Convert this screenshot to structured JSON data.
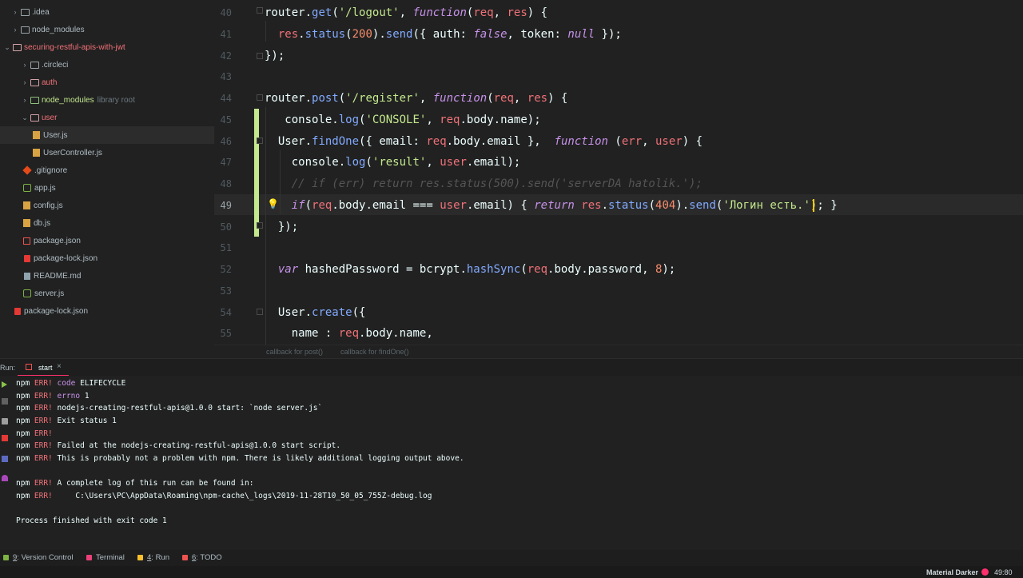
{
  "project_tree": {
    "items": [
      {
        "label": ".idea",
        "kind": "folder",
        "color": "#b0bec5",
        "chev": "›"
      },
      {
        "label": "node_modules",
        "kind": "folder",
        "color": "#b0bec5",
        "chev": "›"
      },
      {
        "label": "securing-restful-apis-with-jwt",
        "kind": "folder",
        "color": "#f07178",
        "chev": "⌄"
      },
      {
        "label": ".circleci",
        "kind": "folder",
        "color": "#b0bec5",
        "chev": "›"
      },
      {
        "label": "auth",
        "kind": "folder",
        "color": "#f07178",
        "chev": "›"
      },
      {
        "label": "node_modules",
        "suffix": "library root",
        "kind": "folder",
        "color": "#c3e88d",
        "chev": "›"
      },
      {
        "label": "user",
        "kind": "folder",
        "color": "#f07178",
        "chev": "⌄"
      },
      {
        "label": "User.js",
        "kind": "js",
        "color": "#b0bec5"
      },
      {
        "label": "UserController.js",
        "kind": "js",
        "color": "#b0bec5"
      },
      {
        "label": ".gitignore",
        "kind": "git",
        "color": "#b0bec5"
      },
      {
        "label": "app.js",
        "kind": "jsgreen",
        "color": "#b0bec5"
      },
      {
        "label": "config.js",
        "kind": "js",
        "color": "#b0bec5"
      },
      {
        "label": "db.js",
        "kind": "js",
        "color": "#b0bec5"
      },
      {
        "label": "package.json",
        "kind": "pkg",
        "color": "#b0bec5"
      },
      {
        "label": "package-lock.json",
        "kind": "lock",
        "color": "#b0bec5"
      },
      {
        "label": "README.md",
        "kind": "md",
        "color": "#b0bec5"
      },
      {
        "label": "server.js",
        "kind": "jsgreen",
        "color": "#b0bec5"
      },
      {
        "label": "package-lock.json",
        "kind": "lock",
        "color": "#b0bec5"
      }
    ]
  },
  "editor": {
    "line_numbers": [
      "40",
      "41",
      "42",
      "43",
      "44",
      "45",
      "46",
      "47",
      "48",
      "49",
      "50",
      "51",
      "52",
      "53",
      "54",
      "55"
    ],
    "current_line": "49",
    "lines": [
      [
        [
          "d",
          "router."
        ],
        [
          "f",
          "get"
        ],
        [
          "p",
          "("
        ],
        [
          "s",
          "'/logout'"
        ],
        [
          "p",
          ", "
        ],
        [
          "k",
          "function"
        ],
        [
          "p",
          "("
        ],
        [
          "v",
          "req"
        ],
        [
          "p",
          ", "
        ],
        [
          "v",
          "res"
        ],
        [
          "p",
          ") {"
        ]
      ],
      [
        [
          "d",
          "  "
        ],
        [
          "v",
          "res"
        ],
        [
          "p",
          "."
        ],
        [
          "f",
          "status"
        ],
        [
          "p",
          "("
        ],
        [
          "n",
          "200"
        ],
        [
          "p",
          ")."
        ],
        [
          "f",
          "send"
        ],
        [
          "p",
          "({ "
        ],
        [
          "d",
          "auth"
        ],
        [
          "p",
          ": "
        ],
        [
          "k",
          "false"
        ],
        [
          "p",
          ", "
        ],
        [
          "d",
          "token"
        ],
        [
          "p",
          ": "
        ],
        [
          "k",
          "null"
        ],
        [
          "p",
          " });"
        ]
      ],
      [
        [
          "p",
          "});"
        ]
      ],
      [],
      [
        [
          "d",
          "router."
        ],
        [
          "f",
          "post"
        ],
        [
          "p",
          "("
        ],
        [
          "s",
          "'/register'"
        ],
        [
          "p",
          ", "
        ],
        [
          "k",
          "function"
        ],
        [
          "p",
          "("
        ],
        [
          "v",
          "req"
        ],
        [
          "p",
          ", "
        ],
        [
          "v",
          "res"
        ],
        [
          "p",
          ") {"
        ]
      ],
      [
        [
          "d",
          "   console."
        ],
        [
          "f",
          "log"
        ],
        [
          "p",
          "("
        ],
        [
          "s",
          "'CONSOLE'"
        ],
        [
          "p",
          ", "
        ],
        [
          "v",
          "req"
        ],
        [
          "p",
          "."
        ],
        [
          "d",
          "body"
        ],
        [
          "p",
          "."
        ],
        [
          "d",
          "name"
        ],
        [
          "p",
          ");"
        ]
      ],
      [
        [
          "d",
          "  User."
        ],
        [
          "f",
          "findOne"
        ],
        [
          "p",
          "({ "
        ],
        [
          "d",
          "email"
        ],
        [
          "p",
          ": "
        ],
        [
          "v",
          "req"
        ],
        [
          "p",
          "."
        ],
        [
          "d",
          "body"
        ],
        [
          "p",
          "."
        ],
        [
          "d",
          "email"
        ],
        [
          "p",
          " },  "
        ],
        [
          "k",
          "function"
        ],
        [
          "p",
          " ("
        ],
        [
          "v",
          "err"
        ],
        [
          "p",
          ", "
        ],
        [
          "v",
          "user"
        ],
        [
          "p",
          ") {"
        ]
      ],
      [
        [
          "d",
          "    console."
        ],
        [
          "f",
          "log"
        ],
        [
          "p",
          "("
        ],
        [
          "s",
          "'result'"
        ],
        [
          "p",
          ", "
        ],
        [
          "v",
          "user"
        ],
        [
          "p",
          "."
        ],
        [
          "d",
          "email"
        ],
        [
          "p",
          ");"
        ]
      ],
      [
        [
          "c",
          "    // if (err) return res.status(500).send('serverDA hatolik.');"
        ]
      ],
      [
        [
          "d",
          "    "
        ],
        [
          "k",
          "if"
        ],
        [
          "p",
          "("
        ],
        [
          "v",
          "req"
        ],
        [
          "p",
          "."
        ],
        [
          "d",
          "body"
        ],
        [
          "p",
          "."
        ],
        [
          "d",
          "email"
        ],
        [
          "p",
          " === "
        ],
        [
          "v",
          "user"
        ],
        [
          "p",
          "."
        ],
        [
          "d",
          "email"
        ],
        [
          "p",
          ") { "
        ],
        [
          "k",
          "return"
        ],
        [
          "p",
          " "
        ],
        [
          "v",
          "res"
        ],
        [
          "p",
          "."
        ],
        [
          "f",
          "status"
        ],
        [
          "p",
          "("
        ],
        [
          "n",
          "404"
        ],
        [
          "p",
          ")."
        ],
        [
          "f",
          "send"
        ],
        [
          "p",
          "("
        ],
        [
          "s",
          "'Логин есть.'"
        ],
        [
          "p",
          "); }"
        ]
      ],
      [
        [
          "p",
          "  });"
        ]
      ],
      [],
      [
        [
          "d",
          "  "
        ],
        [
          "k",
          "var"
        ],
        [
          "d",
          " hashedPassword = bcrypt."
        ],
        [
          "f",
          "hashSync"
        ],
        [
          "p",
          "("
        ],
        [
          "v",
          "req"
        ],
        [
          "p",
          "."
        ],
        [
          "d",
          "body"
        ],
        [
          "p",
          "."
        ],
        [
          "d",
          "password"
        ],
        [
          "p",
          ", "
        ],
        [
          "n",
          "8"
        ],
        [
          "p",
          ");"
        ]
      ],
      [],
      [
        [
          "d",
          "  User."
        ],
        [
          "f",
          "create"
        ],
        [
          "p",
          "({"
        ]
      ],
      [
        [
          "d",
          "    name "
        ],
        [
          "p",
          ": "
        ],
        [
          "v",
          "req"
        ],
        [
          "p",
          "."
        ],
        [
          "d",
          "body"
        ],
        [
          "p",
          "."
        ],
        [
          "d",
          "name"
        ],
        [
          "p",
          ","
        ]
      ]
    ]
  },
  "breadcrumb": {
    "items": [
      "callback for post()",
      "callback for findOne()"
    ]
  },
  "run_panel": {
    "label": "Run:",
    "tab": "start",
    "close": "×"
  },
  "console": {
    "lines": [
      [
        [
          "w",
          "npm "
        ],
        [
          "r",
          "ERR! "
        ],
        [
          "m",
          "code"
        ],
        [
          "w",
          " ELIFECYCLE"
        ]
      ],
      [
        [
          "w",
          "npm "
        ],
        [
          "r",
          "ERR! "
        ],
        [
          "m",
          "errno"
        ],
        [
          "w",
          " 1"
        ]
      ],
      [
        [
          "w",
          "npm "
        ],
        [
          "r",
          "ERR! "
        ],
        [
          "w",
          "nodejs-creating-restful-apis@1.0.0 start: `node server.js`"
        ]
      ],
      [
        [
          "w",
          "npm "
        ],
        [
          "r",
          "ERR! "
        ],
        [
          "w",
          "Exit status 1"
        ]
      ],
      [
        [
          "w",
          "npm "
        ],
        [
          "r",
          "ERR!"
        ]
      ],
      [
        [
          "w",
          "npm "
        ],
        [
          "r",
          "ERR! "
        ],
        [
          "w",
          "Failed at the nodejs-creating-restful-apis@1.0.0 start script."
        ]
      ],
      [
        [
          "w",
          "npm "
        ],
        [
          "r",
          "ERR! "
        ],
        [
          "w",
          "This is probably not a problem with npm. There is likely additional logging output above."
        ]
      ],
      [],
      [
        [
          "w",
          "npm "
        ],
        [
          "r",
          "ERR! "
        ],
        [
          "w",
          "A complete log of this run can be found in:"
        ]
      ],
      [
        [
          "w",
          "npm "
        ],
        [
          "r",
          "ERR!     "
        ],
        [
          "w",
          "C:\\Users\\PC\\AppData\\Roaming\\npm-cache\\_logs\\2019-11-28T10_50_05_755Z-debug.log"
        ]
      ],
      [],
      [
        [
          "w",
          "Process finished with exit code 1"
        ]
      ]
    ]
  },
  "bottom_tabs": {
    "items": [
      {
        "num": "9",
        "label": ": Version Control",
        "icon": "vcs-icon"
      },
      {
        "num": "",
        "label": "Terminal",
        "icon": "terminal-icon"
      },
      {
        "num": "4",
        "label": ": Run",
        "icon": "run-icon"
      },
      {
        "num": "6",
        "label": ": TODO",
        "icon": "todo-icon"
      }
    ]
  },
  "status_bar": {
    "theme": "Material Darker",
    "position": "49:80"
  },
  "colors": {
    "keyword": "#c792ea",
    "function": "#82aaff",
    "string": "#c3e88d",
    "number": "#f78c6c",
    "variable": "#f07178",
    "default": "#eeffff",
    "punct": "#89ddff",
    "comment": "#545454",
    "err_red": "#f07178",
    "err_magenta": "#c792ea",
    "accent": "#ff2f6e"
  }
}
